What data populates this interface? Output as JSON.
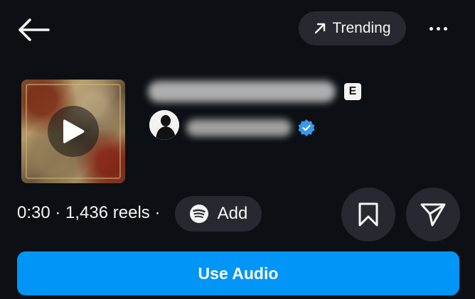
{
  "header": {
    "back_icon": "arrow-left-icon",
    "trending_label": "Trending",
    "trending_icon": "arrow-up-right-icon",
    "more_icon": "more-horizontal-icon"
  },
  "track": {
    "title": "",
    "explicit_label": "E",
    "artist": "",
    "artist_verified": true
  },
  "meta": {
    "duration": "0:30",
    "reels_count": "1,436 reels",
    "separator": "·",
    "text": "0:30 · 1,436 reels ·"
  },
  "actions": {
    "add_label": "Add",
    "add_icon": "spotify-icon",
    "save_icon": "bookmark-icon",
    "share_icon": "send-icon",
    "use_audio_label": "Use Audio"
  },
  "colors": {
    "background": "#0c1014",
    "pill": "#262a30",
    "primary": "#0095f6",
    "verified": "#3897f0"
  }
}
